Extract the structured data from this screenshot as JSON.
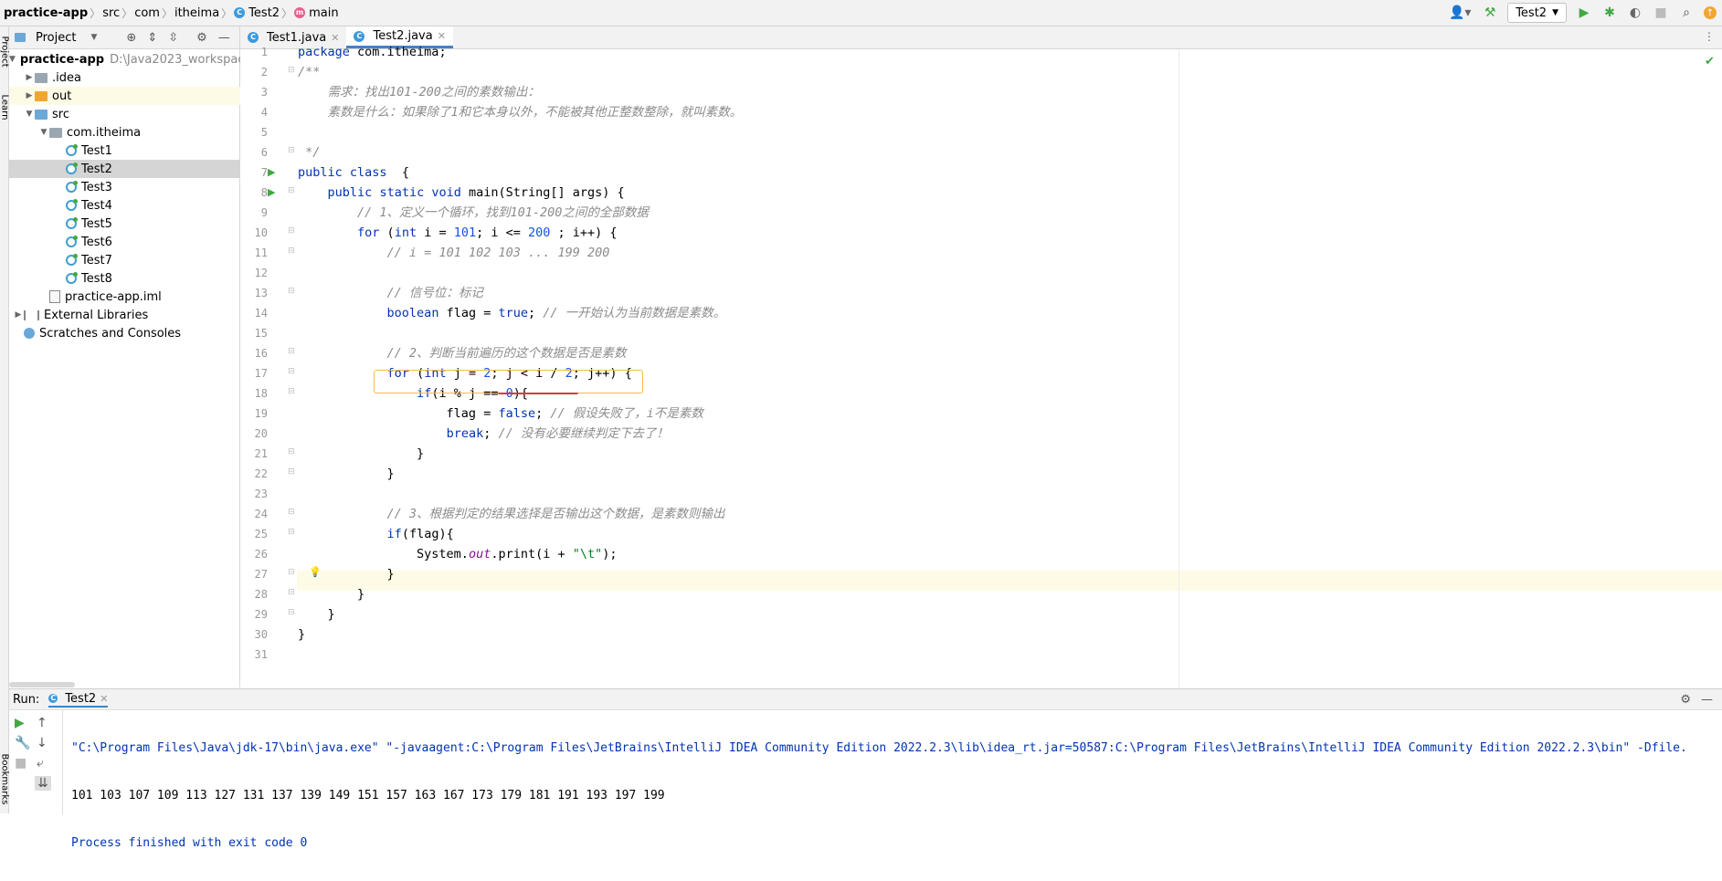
{
  "breadcrumb": {
    "project": "practice-app",
    "items": [
      "src",
      "com",
      "itheima",
      "Test2",
      "main"
    ]
  },
  "toolbar": {
    "run_config": "Test2",
    "user_icon": "user-icon",
    "build_icon": "hammer-icon",
    "run_icon": "run-icon",
    "debug_icon": "debug-icon",
    "coverage_icon": "coverage-icon",
    "stop_icon": "stop-icon",
    "search_icon": "search-icon",
    "update_icon": "update-icon"
  },
  "side_strip": {
    "project_label": "Project",
    "learn_label": "Learn",
    "bookmarks_label": "Bookmarks"
  },
  "project_panel": {
    "title": "Project",
    "root_name": "practice-app",
    "root_path": "D:\\Java2023_workspace",
    "items": [
      {
        "label": "practice-app",
        "path": "D:\\Java2023_workspace"
      },
      {
        "label": ".idea"
      },
      {
        "label": "out"
      },
      {
        "label": "src"
      },
      {
        "label": "com.itheima"
      },
      {
        "label": "Test1"
      },
      {
        "label": "Test2"
      },
      {
        "label": "Test3"
      },
      {
        "label": "Test4"
      },
      {
        "label": "Test5"
      },
      {
        "label": "Test6"
      },
      {
        "label": "Test7"
      },
      {
        "label": "Test8"
      },
      {
        "label": "practice-app.iml"
      },
      {
        "label": "External Libraries"
      },
      {
        "label": "Scratches and Consoles"
      }
    ]
  },
  "editor": {
    "tabs": [
      {
        "label": "Test1.java",
        "active": false
      },
      {
        "label": "Test2.java",
        "active": true
      }
    ],
    "lines": [
      "package com.itheima;",
      "/**",
      "    需求：找出101-200之间的素数输出：",
      "    素数是什么：如果除了1和它本身以外，不能被其他正整数整除，就叫素数。",
      "",
      " */",
      "public class Test2 {",
      "    public static void main(String[] args) {",
      "        // 1、定义一个循环，找到101-200之间的全部数据",
      "        for (int i = 101; i <= 200 ; i++) {",
      "            // i = 101 102 103 ... 199 200",
      "",
      "            // 信号位：标记",
      "            boolean flag = true; // 一开始认为当前数据是素数。",
      "",
      "            // 2、判断当前遍历的这个数据是否是素数",
      "            for (int j = 2; j < i / 2; j++) {",
      "                if(i % j == 0){",
      "                    flag = false; // 假设失败了，i不是素数",
      "                    break; // 没有必要继续判定下去了！",
      "                }",
      "            }",
      "",
      "            // 3、根据判定的结果选择是否输出这个数据，是素数则输出",
      "            if(flag){",
      "                System.out.print(i + \"\\t\");",
      "            }",
      "        }",
      "    }",
      "}",
      ""
    ]
  },
  "run_panel": {
    "label": "Run:",
    "tab": "Test2",
    "console": [
      "\"C:\\Program Files\\Java\\jdk-17\\bin\\java.exe\" \"-javaagent:C:\\Program Files\\JetBrains\\IntelliJ IDEA Community Edition 2022.2.3\\lib\\idea_rt.jar=50587:C:\\Program Files\\JetBrains\\IntelliJ IDEA Community Edition 2022.2.3\\bin\" -Dfile.",
      "101 103 107 109 113 127 131 137 139 149 151 157 163 167 173 179 181 191 193 197 199",
      "Process finished with exit code 0"
    ]
  }
}
